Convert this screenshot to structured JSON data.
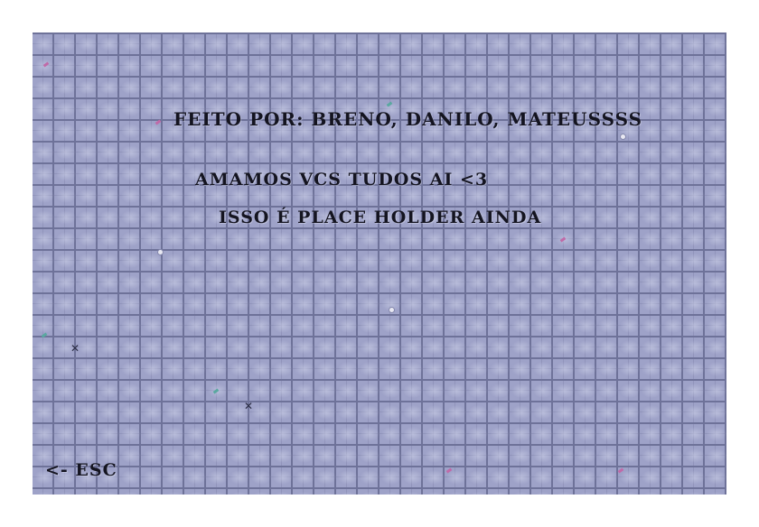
{
  "screen": {
    "credits_text": "FEITO POR: BRENO, DANILO, MATEUSSSS",
    "love_text": "AMAMOS VCS TUDOS AI <3",
    "placeholder_text": "ISSO É PLACE HOLDER AINDA",
    "esc_label": "<- ESC"
  },
  "colors": {
    "floor": "#9ea2c8",
    "grout": "#6e7299",
    "text": "#141420",
    "pink_deco": "#c06aa8",
    "teal_deco": "#5aa8a0"
  },
  "decorations": [
    "pink-sprout",
    "teal-sprout",
    "pebble",
    "bone"
  ]
}
